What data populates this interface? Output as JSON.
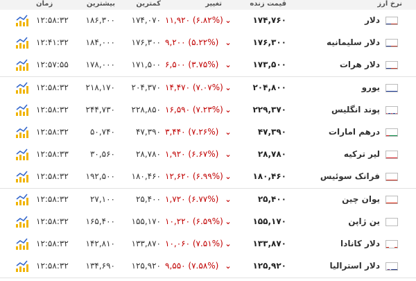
{
  "header": {
    "name": "نرخ ارز",
    "price": "قیمت زنده",
    "change": "تغییر",
    "low": "کمترین",
    "high": "بیشترین",
    "time": "زمان",
    "colors": {
      "background": "#f3f3f3",
      "border": "#dddddd"
    }
  },
  "colors": {
    "negative": "#c00000",
    "chart_bar": "#f0b400",
    "chart_line": "#3366cc"
  },
  "rows": [
    {
      "name": "دلار",
      "price": "۱۷۴,۷۶۰",
      "change": "۱۱,۹۲۰ (۶.۸۲%)",
      "low": "۱۷۴,۰۷۰",
      "high": "۱۸۶,۳۰۰",
      "time": "۱۲:۵۸:۳۲",
      "flag": "us-flag-icon"
    },
    {
      "name": "دلار سلیمانیه",
      "price": "۱۷۶,۳۰۰",
      "change": "۹,۲۰۰ (۵.۲۲%)",
      "low": "۱۷۶,۳۰۰",
      "high": "۱۸۴,۰۰۰",
      "time": "۱۲:۴۱:۳۲",
      "flag": "us-flag-icon"
    },
    {
      "name": "دلار هرات",
      "price": "۱۷۳,۵۰۰",
      "change": "۶,۵۰۰ (۳.۷۵%)",
      "low": "۱۷۱,۵۰۰",
      "high": "۱۷۸,۰۰۰",
      "time": "۱۲:۵۷:۵۵",
      "flag": "us-flag-icon"
    },
    {
      "name": "یورو",
      "price": "۲۰۴,۸۰۰",
      "change": "۱۴,۴۷۰ (۷.۰۷%)",
      "low": "۲۰۴,۳۷۰",
      "high": "۲۱۸,۱۷۰",
      "time": "۱۲:۵۸:۳۲",
      "flag": "eu-flag-icon"
    },
    {
      "name": "پوند انگلیس",
      "price": "۲۲۹,۳۷۰",
      "change": "۱۶,۵۹۰ (۷.۲۳%)",
      "low": "۲۲۸,۸۵۰",
      "high": "۲۴۴,۷۳۰",
      "time": "۱۲:۵۸:۳۲",
      "flag": "gb-flag-icon"
    },
    {
      "name": "درهم امارات",
      "price": "۴۷,۳۹۰",
      "change": "۳,۴۴۰ (۷.۲۶%)",
      "low": "۴۷,۳۹۰",
      "high": "۵۰,۷۴۰",
      "time": "۱۲:۵۸:۳۲",
      "flag": "ae-flag-icon"
    },
    {
      "name": "لیر ترکیه",
      "price": "۲۸,۷۸۰",
      "change": "۱,۹۲۰ (۶.۶۷%)",
      "low": "۲۸,۷۸۰",
      "high": "۳۰,۵۶۰",
      "time": "۱۲:۵۸:۳۳",
      "flag": "tr-flag-icon"
    },
    {
      "name": "فرانک سوئیس",
      "price": "۱۸۰,۴۶۰",
      "change": "۱۲,۶۲۰ (۶.۹۹%)",
      "low": "۱۸۰,۴۶۰",
      "high": "۱۹۲,۵۰۰",
      "time": "۱۲:۵۸:۳۲",
      "flag": "ch-flag-icon"
    },
    {
      "name": "یوان چین",
      "price": "۲۵,۴۰۰",
      "change": "۱,۷۲۰ (۶.۷۷%)",
      "low": "۲۵,۴۰۰",
      "high": "۲۷,۱۰۰",
      "time": "۱۲:۵۸:۳۲",
      "flag": "cn-flag-icon"
    },
    {
      "name": "ین ژاپن",
      "price": "۱۵۵,۱۷۰",
      "change": "۱۰,۲۲۰ (۶.۵۹%)",
      "low": "۱۵۵,۱۷۰",
      "high": "۱۶۵,۴۰۰",
      "time": "۱۲:۵۸:۳۲",
      "flag": "jp-flag-icon"
    },
    {
      "name": "دلار کانادا",
      "price": "۱۳۳,۸۷۰",
      "change": "۱۰,۰۶۰ (۷.۵۱%)",
      "low": "۱۳۳,۸۷۰",
      "high": "۱۴۲,۸۱۰",
      "time": "۱۲:۵۸:۳۲",
      "flag": "ca-flag-icon"
    },
    {
      "name": "دلار استرالیا",
      "price": "۱۲۵,۹۲۰",
      "change": "۹,۵۵۰ (۷.۵۸%)",
      "low": "۱۲۵,۹۲۰",
      "high": "۱۳۴,۶۹۰",
      "time": "۱۲:۵۸:۳۲",
      "flag": "au-flag-icon"
    }
  ]
}
